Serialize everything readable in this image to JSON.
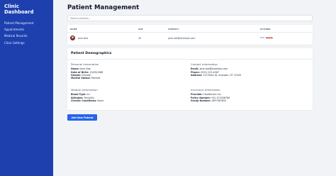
{
  "sidebar": {
    "title_line1": "Clinic",
    "title_line2": "Dashboard",
    "items": [
      {
        "label": "Patient Management"
      },
      {
        "label": "Appointments"
      },
      {
        "label": "Medical Records"
      },
      {
        "label": "Clinic Settings"
      }
    ]
  },
  "main": {
    "title": "Patient Management",
    "search": {
      "placeholder": "Search patients...",
      "value": ""
    },
    "table": {
      "headers": {
        "name": "NAME",
        "age": "AGE",
        "contact": "CONTACT",
        "actions": "ACTIONS"
      },
      "rows": [
        {
          "name": "Jane Doe",
          "age": "45",
          "contact": "jane.doe@example.com",
          "edit": "Edit",
          "delete": "Delete"
        }
      ]
    },
    "demographics": {
      "title": "Patient Demographics",
      "personal": {
        "heading": "Personal Information",
        "fields": [
          {
            "label": "Name:",
            "value": "Jane Doe"
          },
          {
            "label": "Date of Birth:",
            "value": "15/05/1988"
          },
          {
            "label": "Gender:",
            "value": "Female"
          },
          {
            "label": "Marital Status:",
            "value": "Married"
          }
        ]
      },
      "contact": {
        "heading": "Contact Information",
        "fields": [
          {
            "label": "Email:",
            "value": "jane.doe@example.com"
          },
          {
            "label": "Phone:",
            "value": "(555) 123-4567"
          },
          {
            "label": "Address:",
            "value": "123 Main St, Anytown, ST 12345"
          }
        ]
      },
      "medical": {
        "heading": "Medical Information",
        "fields": [
          {
            "label": "Blood Type:",
            "value": "A+"
          },
          {
            "label": "Allergies:",
            "value": "Penicillin"
          },
          {
            "label": "Chronic Conditions:",
            "value": "None"
          }
        ]
      },
      "insurance": {
        "heading": "Insurance Information",
        "fields": [
          {
            "label": "Provider:",
            "value": "HealthCare Inc."
          },
          {
            "label": "Policy Number:",
            "value": "HCI-123456789"
          },
          {
            "label": "Group Number:",
            "value": "GRP-987654"
          }
        ]
      }
    },
    "add_button_label": "Add New Patient"
  }
}
